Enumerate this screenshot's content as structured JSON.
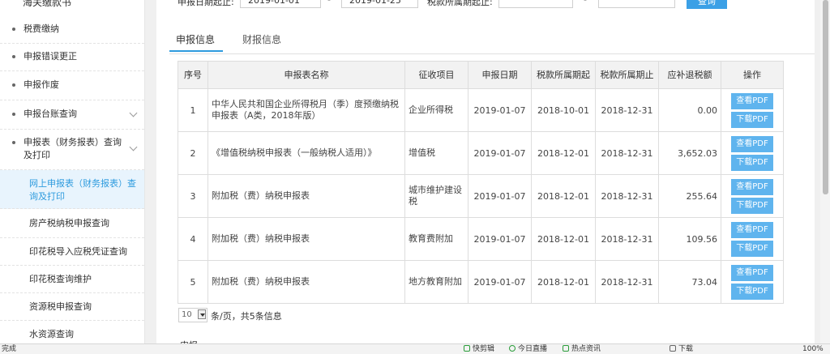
{
  "sidebar": {
    "top_fragment": "海关缴款书",
    "items": [
      {
        "label": "税费缴纳",
        "expandable": false
      },
      {
        "label": "申报错误更正",
        "expandable": false
      },
      {
        "label": "申报作废",
        "expandable": false
      },
      {
        "label": "申报台账查询",
        "expandable": true
      },
      {
        "label": "申报表（财务报表）查询及打印",
        "expandable": true
      }
    ],
    "subitems": [
      {
        "label": "网上申报表（财务报表）查询及打印",
        "active": true
      },
      {
        "label": "房产税纳税申报查询",
        "active": false
      },
      {
        "label": "印花税导入应税凭证查询",
        "active": false
      },
      {
        "label": "印花税查询维护",
        "active": false
      },
      {
        "label": "资源税申报查询",
        "active": false
      },
      {
        "label": "水资源查询",
        "active": false
      }
    ]
  },
  "filter": {
    "date_label": "申报日期起止:",
    "date_from": "2019-01-01",
    "dash": "-",
    "date_to": "2019-01-25",
    "period_label": "税款所属期起止:",
    "period_from": "",
    "period_to": "",
    "query_button": "查询"
  },
  "tabs": [
    {
      "label": "申报信息",
      "active": true
    },
    {
      "label": "财报信息",
      "active": false
    }
  ],
  "table": {
    "headers": [
      "序号",
      "申报表名称",
      "征收项目",
      "申报日期",
      "税款所属期起",
      "税款所属期止",
      "应补退税额",
      "操作"
    ],
    "view_label": "查看PDF",
    "download_label": "下载PDF",
    "rows": [
      {
        "no": "1",
        "name": "中华人民共和国企业所得税月（季）度预缴纳税申报表（A类，2018年版）",
        "item": "企业所得税",
        "date": "2019-01-07",
        "start": "2018-10-01",
        "end": "2018-12-31",
        "amount": "0.00"
      },
      {
        "no": "2",
        "name": "《增值税纳税申报表（一般纳税人适用）》",
        "item": "增值税",
        "date": "2019-01-07",
        "start": "2018-12-01",
        "end": "2018-12-31",
        "amount": "3,652.03"
      },
      {
        "no": "3",
        "name": "附加税（费）纳税申报表",
        "item": "城市维护建设税",
        "date": "2019-01-07",
        "start": "2018-12-01",
        "end": "2018-12-31",
        "amount": "255.64"
      },
      {
        "no": "4",
        "name": "附加税（费）纳税申报表",
        "item": "教育费附加",
        "date": "2019-01-07",
        "start": "2018-12-01",
        "end": "2018-12-31",
        "amount": "109.56"
      },
      {
        "no": "5",
        "name": "附加税（费）纳税申报表",
        "item": "地方教育附加",
        "date": "2019-01-07",
        "start": "2018-12-01",
        "end": "2018-12-31",
        "amount": "73.04"
      }
    ]
  },
  "pager": {
    "page_size": "10",
    "summary": "条/页，共5条信息"
  },
  "bottom_fragment": "申报",
  "statusbar": {
    "left": "完成",
    "items": [
      "快剪辑",
      "今日直播",
      "热点资讯",
      "下载",
      "100%"
    ]
  }
}
